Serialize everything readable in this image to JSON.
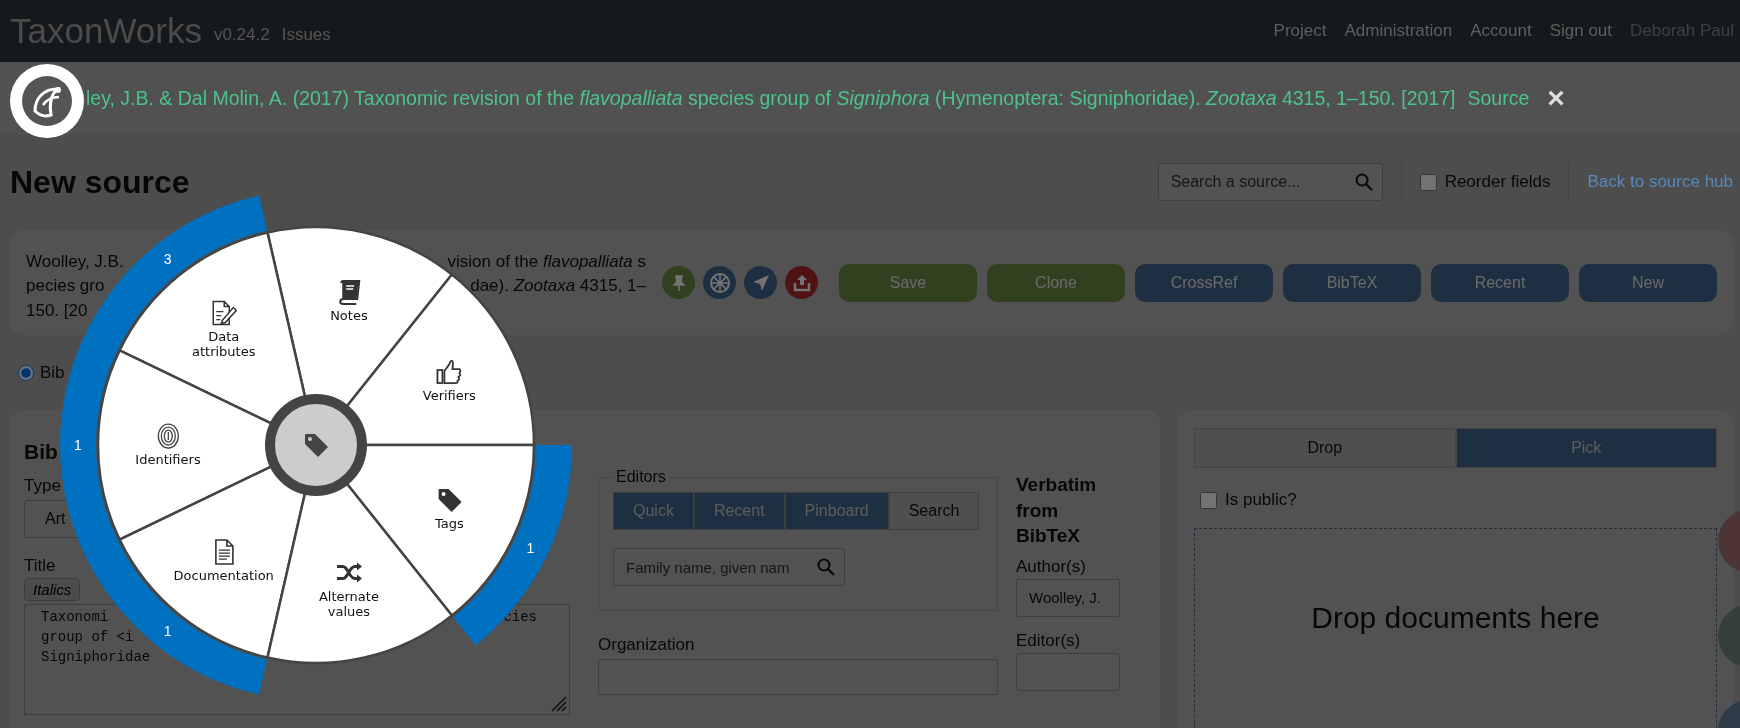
{
  "top_bar": {
    "brand": "TaxonWorks",
    "version": "v0.24.2",
    "issues_link": "Issues",
    "nav": [
      {
        "label": "Project",
        "kind": "link"
      },
      {
        "label": "Administration",
        "kind": "link"
      },
      {
        "label": "Account",
        "kind": "link"
      },
      {
        "label": "Sign out",
        "kind": "link"
      },
      {
        "label": "Deborah Paul",
        "kind": "user"
      }
    ]
  },
  "banner": {
    "citation": "ley, J.B. & Dal Molin, A. (2017) Taxonomic revision of the *flavopalliata* species group of *Signiphora* (Hymenoptera: Signiphoridae). *Zootaxa* 4315, 1–150. [2017]",
    "type_label": "Source",
    "close": "×"
  },
  "header": {
    "title": "New source",
    "search": {
      "placeholder": "Search a source..."
    },
    "reorder_fields": {
      "label": "Reorder fields",
      "checked": false
    },
    "back_link": "Back to source hub"
  },
  "source_card": {
    "citation_lines": [
      {
        "left": "Woolley, J.B.",
        "right": "vision of the *flavopalliata* s"
      },
      {
        "left": "pecies gro",
        "right": "dae). *Zootaxa* 4315, 1–"
      },
      {
        "left": "150. [20"
      }
    ],
    "buttons": [
      {
        "label": "Save",
        "kind": "create"
      },
      {
        "label": "Clone",
        "kind": "create"
      },
      {
        "label": "CrossRef",
        "kind": "action"
      },
      {
        "label": "BibTeX",
        "kind": "action"
      },
      {
        "label": "Recent",
        "kind": "action"
      },
      {
        "label": "New",
        "kind": "action"
      }
    ]
  },
  "source_type": {
    "options": [
      {
        "label": "Bib",
        "selected": true
      }
    ]
  },
  "bibtex_panel": {
    "heading": "Bib",
    "type": {
      "label": "Type",
      "value": "Art"
    },
    "title": {
      "label": "Title",
      "italics_button": "Italics",
      "value_lines": [
        {
          "left": "Taxonomi",
          "right": "cies"
        },
        {
          "left": "group of <i"
        },
        {
          "left": "Signiphoridae"
        }
      ]
    },
    "editors": {
      "legend": "Editors",
      "tabs": [
        {
          "label": "Quick",
          "selected": false
        },
        {
          "label": "Recent",
          "selected": false
        },
        {
          "label": "Pinboard",
          "selected": false
        },
        {
          "label": "Search",
          "selected": true
        }
      ],
      "search": {
        "placeholder": "Family name, given nam"
      }
    },
    "organization": {
      "label": "Organization"
    },
    "verbatim": {
      "heading": "Verbatim from BibTeX",
      "authors": {
        "label": "Author(s)",
        "value": "Woolley, J."
      },
      "editors": {
        "label": "Editor(s)"
      }
    }
  },
  "documents_panel": {
    "tabs": [
      {
        "label": "Drop",
        "selected": true
      },
      {
        "label": "Pick",
        "selected": false
      }
    ],
    "is_public": {
      "label": "Is public?",
      "checked": false
    },
    "dropzone": "Drop documents here"
  },
  "radial_menu": {
    "items": [
      {
        "label": "Notes",
        "kind": "notes"
      },
      {
        "label": "Data attributes",
        "kind": "data_attributes",
        "count": "3"
      },
      {
        "label": "Verifiers",
        "kind": "verifiers"
      },
      {
        "label": "Identifiers",
        "kind": "identifiers",
        "count": "1"
      },
      {
        "label": "Tags",
        "kind": "tags",
        "count": "1"
      },
      {
        "label": "Documentation",
        "kind": "documentation",
        "count": "1"
      },
      {
        "label": "Alternate values",
        "kind": "alternate_values"
      }
    ]
  },
  "floating_buttons": [
    {
      "color": "#4e3535"
    },
    {
      "color": "#36403a"
    },
    {
      "color": "#2d3a47"
    }
  ]
}
